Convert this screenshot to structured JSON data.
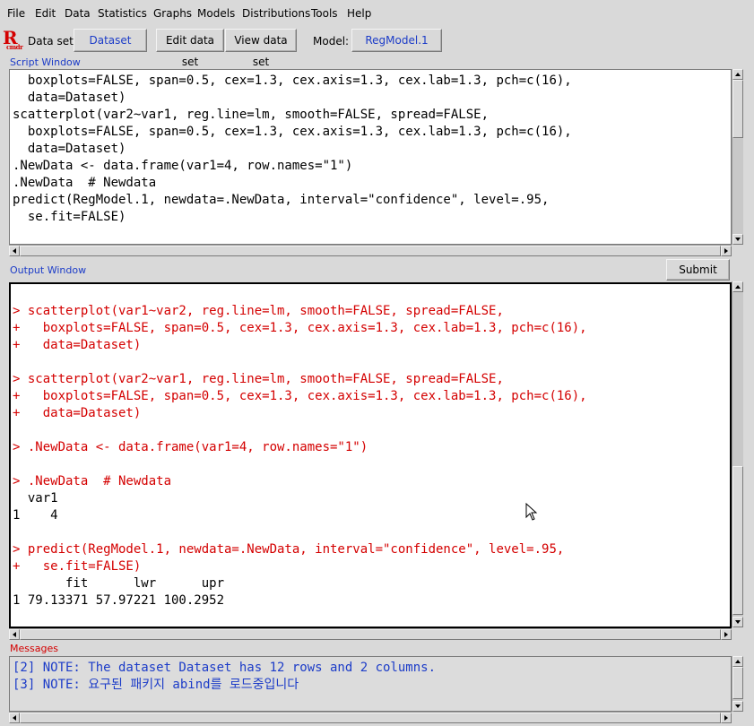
{
  "menu": [
    "File",
    "Edit",
    "Data",
    "Statistics",
    "Graphs",
    "Models",
    "Distributions",
    "Tools",
    "Help"
  ],
  "toolbar": {
    "logo_r": "R",
    "logo_cmd": "cmdr",
    "dataset_label": "Data set:",
    "dataset_value": "Dataset",
    "edit_data_set": "Edit data set",
    "view_data_set": "View data set",
    "model_label": "Model:",
    "model_value": "RegModel.1"
  },
  "script": {
    "title": "Script Window",
    "lines": [
      "  boxplots=FALSE, span=0.5, cex=1.3, cex.axis=1.3, cex.lab=1.3, pch=c(16),",
      "  data=Dataset)",
      "scatterplot(var2~var1, reg.line=lm, smooth=FALSE, spread=FALSE,",
      "  boxplots=FALSE, span=0.5, cex=1.3, cex.axis=1.3, cex.lab=1.3, pch=c(16),",
      "  data=Dataset)",
      ".NewData <- data.frame(var1=4, row.names=\"1\")",
      ".NewData  # Newdata",
      "predict(RegModel.1, newdata=.NewData, interval=\"confidence\", level=.95,",
      "  se.fit=FALSE)"
    ]
  },
  "output": {
    "title": "Output Window",
    "submit": "Submit",
    "lines": [
      {
        "text": "> scatterplot(var1~var2, reg.line=lm, smooth=FALSE, spread=FALSE,",
        "kind": "cmd"
      },
      {
        "text": "+   boxplots=FALSE, span=0.5, cex=1.3, cex.axis=1.3, cex.lab=1.3, pch=c(16),",
        "kind": "cmd"
      },
      {
        "text": "+   data=Dataset)",
        "kind": "cmd"
      },
      {
        "text": "",
        "kind": "blank"
      },
      {
        "text": "> scatterplot(var2~var1, reg.line=lm, smooth=FALSE, spread=FALSE,",
        "kind": "cmd"
      },
      {
        "text": "+   boxplots=FALSE, span=0.5, cex=1.3, cex.axis=1.3, cex.lab=1.3, pch=c(16),",
        "kind": "cmd"
      },
      {
        "text": "+   data=Dataset)",
        "kind": "cmd"
      },
      {
        "text": "",
        "kind": "blank"
      },
      {
        "text": "> .NewData <- data.frame(var1=4, row.names=\"1\")",
        "kind": "cmd"
      },
      {
        "text": "",
        "kind": "blank"
      },
      {
        "text": "> .NewData  # Newdata",
        "kind": "cmd"
      },
      {
        "text": "  var1",
        "kind": "out"
      },
      {
        "text": "1    4",
        "kind": "out"
      },
      {
        "text": "",
        "kind": "blank"
      },
      {
        "text": "> predict(RegModel.1, newdata=.NewData, interval=\"confidence\", level=.95,",
        "kind": "cmd"
      },
      {
        "text": "+   se.fit=FALSE)",
        "kind": "cmd"
      },
      {
        "text": "       fit      lwr      upr",
        "kind": "out"
      },
      {
        "text": "1 79.13371 57.97221 100.2952",
        "kind": "out"
      }
    ]
  },
  "messages": {
    "title": "Messages",
    "lines": [
      "[2] NOTE: The dataset Dataset has 12 rows and 2 columns.",
      "[3] NOTE: 요구된 패키지 abind를 로드중입니다"
    ]
  },
  "colors": {
    "command": "#d40000",
    "output": "#000000",
    "note": "#1c3cc8"
  }
}
